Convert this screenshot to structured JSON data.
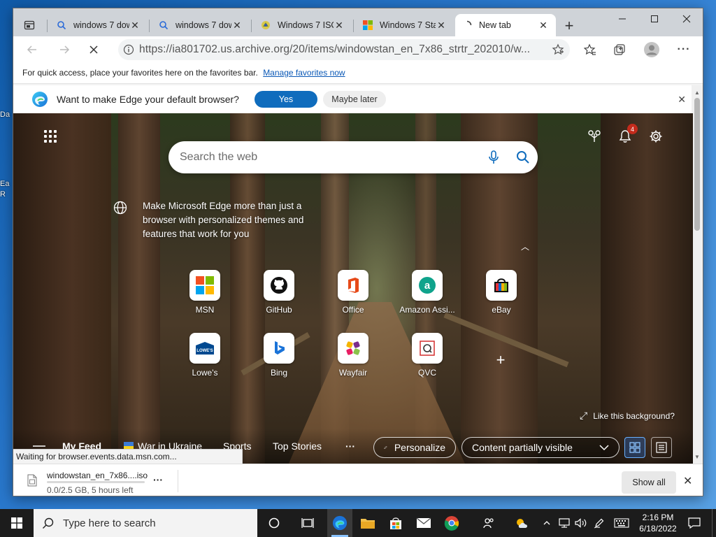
{
  "desktop": {
    "frag1": "Da",
    "frag2": "Ea",
    "frag3": "R"
  },
  "tabs": [
    {
      "title": "windows 7 dow",
      "icon": "search-icon"
    },
    {
      "title": "windows 7 dow",
      "icon": "search-icon"
    },
    {
      "title": "Windows 7 ISO",
      "icon": "site-icon"
    },
    {
      "title": "Windows 7 Sta",
      "icon": "windows-logo-icon"
    },
    {
      "title": "New tab",
      "icon": "loading-icon"
    }
  ],
  "toolbar": {
    "url": "https://ia801702.us.archive.org/20/items/windowstan_en_7x86_strtr_202010/w..."
  },
  "favbar": {
    "text": "For quick access, place your favorites here on the favorites bar.",
    "link": "Manage favorites now"
  },
  "infobar": {
    "message": "Want to make Edge your default browser?",
    "yes": "Yes",
    "later": "Maybe later"
  },
  "ntp": {
    "search_placeholder": "Search the web",
    "notification_count": "4",
    "promo": "Make Microsoft Edge more than just a browser with personalized themes and features that work for you",
    "tiles": [
      {
        "label": "MSN",
        "icon": "msn-icon"
      },
      {
        "label": "GitHub",
        "icon": "github-icon"
      },
      {
        "label": "Office",
        "icon": "office-icon"
      },
      {
        "label": "Amazon Assi...",
        "icon": "amazon-icon"
      },
      {
        "label": "eBay",
        "icon": "ebay-icon"
      },
      {
        "label": "Lowe's",
        "icon": "lowes-icon"
      },
      {
        "label": "Bing",
        "icon": "bing-icon"
      },
      {
        "label": "Wayfair",
        "icon": "wayfair-icon"
      },
      {
        "label": "QVC",
        "icon": "qvc-icon"
      }
    ],
    "bg_prompt": "Like this background?",
    "feed": {
      "my_feed": "My Feed",
      "ukraine": "War in Ukraine",
      "sports": "Sports",
      "top_stories": "Top Stories",
      "more": "···",
      "personalize": "Personalize",
      "content_visibility": "Content partially visible"
    }
  },
  "status": "Waiting for browser.events.data.msn.com...",
  "download": {
    "filename": "windowstan_en_7x86....iso",
    "status": "0.0/2.5 GB, 5 hours left",
    "progress": 0.0,
    "more": "···",
    "show_all": "Show all"
  },
  "taskbar": {
    "search_placeholder": "Type here to search",
    "time": "2:16 PM",
    "date": "6/18/2022"
  },
  "colors": {
    "accent": "#0f6cbd",
    "badge": "#c42b1c"
  }
}
